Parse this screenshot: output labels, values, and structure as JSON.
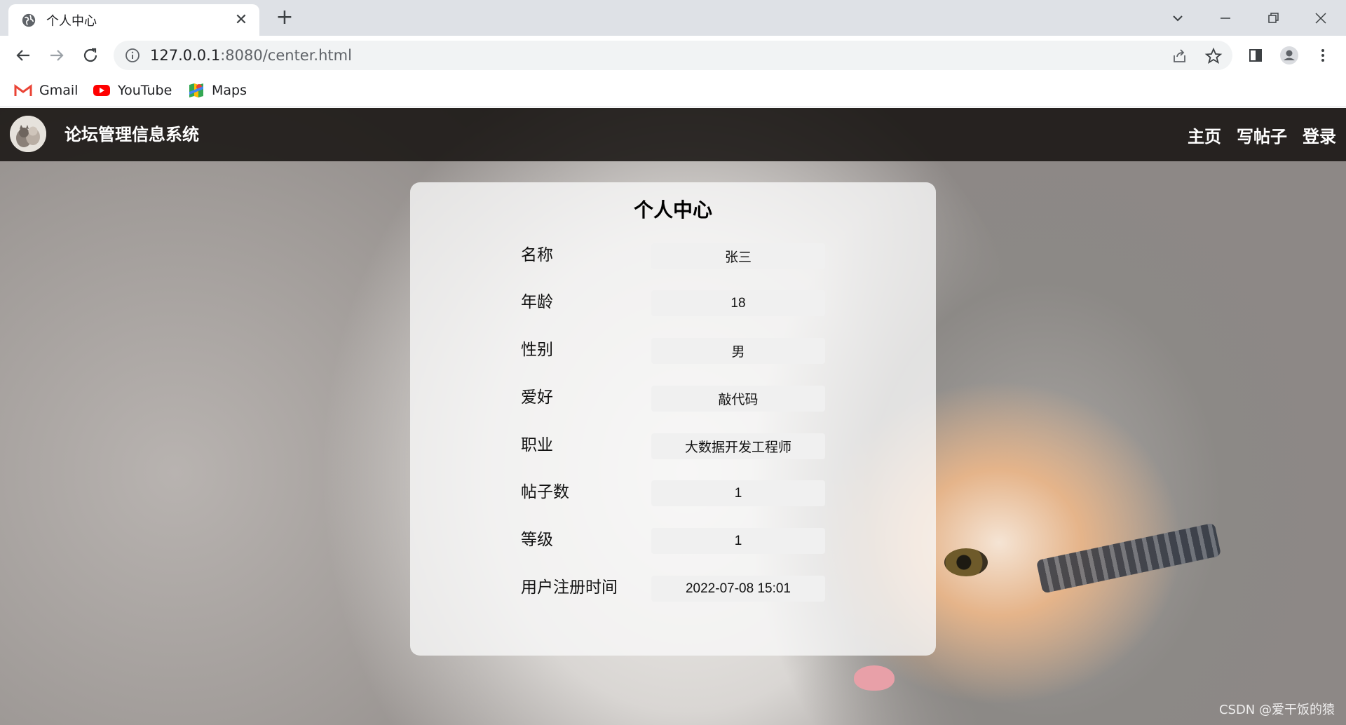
{
  "browser": {
    "tab": {
      "title": "个人中心"
    },
    "address": {
      "host": "127.0.0.1",
      "path": ":8080/center.html"
    },
    "bookmarks": [
      {
        "label": "Gmail",
        "icon": "gmail-icon"
      },
      {
        "label": "YouTube",
        "icon": "youtube-icon"
      },
      {
        "label": "Maps",
        "icon": "maps-icon"
      }
    ]
  },
  "site": {
    "title": "论坛管理信息系统",
    "nav": [
      "主页",
      "写帖子",
      "登录"
    ]
  },
  "profile": {
    "title": "个人中心",
    "fields": [
      {
        "label": "名称",
        "value": "张三"
      },
      {
        "label": "年龄",
        "value": "18"
      },
      {
        "label": "性别",
        "value": "男"
      },
      {
        "label": "爱好",
        "value": "敲代码"
      },
      {
        "label": "职业",
        "value": "大数据开发工程师"
      },
      {
        "label": "帖子数",
        "value": "1"
      },
      {
        "label": "等级",
        "value": "1"
      },
      {
        "label": "用户注册时间",
        "value": "2022-07-08 15:01"
      }
    ]
  },
  "watermark": "CSDN @爱干饭的猿",
  "colors": {
    "header_bg": "#14100e",
    "card_bg": "#f8f8f8",
    "field_bg": "#f0f0f0"
  }
}
